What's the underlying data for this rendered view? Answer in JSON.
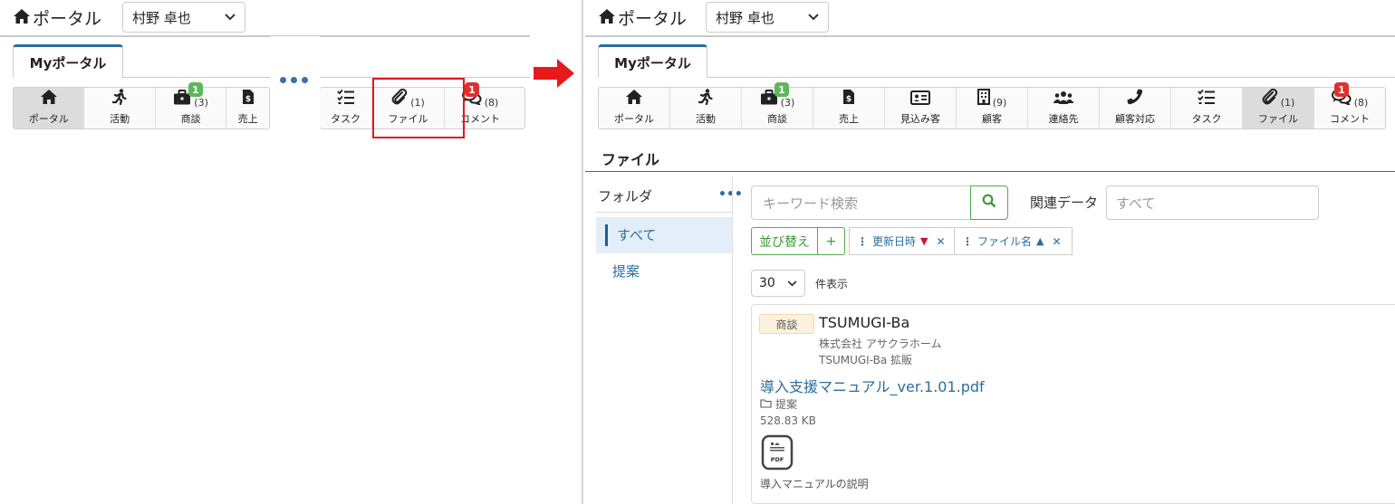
{
  "left": {
    "portal_title": "ポータル",
    "user_select": "村野 卓也",
    "tab_label": "Myポータル",
    "toolbar": [
      {
        "label": "ポータル",
        "icon": "home-icon",
        "glyph": "⌂",
        "count": "",
        "badge": ""
      },
      {
        "label": "活動",
        "icon": "running-icon",
        "glyph": "🏃",
        "count": "",
        "badge": ""
      },
      {
        "label": "商談",
        "icon": "briefcase-icon",
        "glyph": "💼",
        "count": "(3)",
        "badge": "1"
      },
      {
        "label": "売上",
        "icon": "invoice-icon",
        "glyph": "$",
        "count": "",
        "badge": ""
      },
      {
        "label": "タスク",
        "icon": "task-list-icon",
        "glyph": "☰",
        "count": "",
        "badge": ""
      },
      {
        "label": "ファイル",
        "icon": "paperclip-icon",
        "glyph": "📎",
        "count": "(1)",
        "badge": ""
      },
      {
        "label": "コメント",
        "icon": "comments-icon",
        "glyph": "💬",
        "count": "(8)",
        "badge": "1"
      }
    ]
  },
  "arrow_color": "#e8191a",
  "right": {
    "portal_title": "ポータル",
    "user_select": "村野 卓也",
    "tab_label": "Myポータル",
    "toolbar": [
      {
        "label": "ポータル",
        "icon": "home-icon",
        "glyph": "⌂",
        "count": "",
        "badge": ""
      },
      {
        "label": "活動",
        "icon": "running-icon",
        "glyph": "🏃",
        "count": "",
        "badge": ""
      },
      {
        "label": "商談",
        "icon": "briefcase-icon",
        "glyph": "💼",
        "count": "(3)",
        "badge": "1"
      },
      {
        "label": "売上",
        "icon": "invoice-icon",
        "glyph": "$",
        "count": "",
        "badge": ""
      },
      {
        "label": "見込み客",
        "icon": "id-card-icon",
        "glyph": "🪪",
        "count": "",
        "badge": ""
      },
      {
        "label": "顧客",
        "icon": "building-icon",
        "glyph": "🏢",
        "count": "(9)",
        "badge": ""
      },
      {
        "label": "連絡先",
        "icon": "users-icon",
        "glyph": "👥",
        "count": "",
        "badge": ""
      },
      {
        "label": "顧客対応",
        "icon": "phone-icon",
        "glyph": "📞",
        "count": "",
        "badge": ""
      },
      {
        "label": "タスク",
        "icon": "task-list-icon",
        "glyph": "☰",
        "count": "",
        "badge": ""
      },
      {
        "label": "ファイル",
        "icon": "paperclip-icon",
        "glyph": "📎",
        "count": "(1)",
        "badge": ""
      },
      {
        "label": "コメント",
        "icon": "comments-icon",
        "glyph": "💬",
        "count": "(8)",
        "badge": "1"
      }
    ],
    "section_title": "ファイル",
    "folder": {
      "heading": "フォルダ",
      "items": [
        "すべて",
        "提案"
      ]
    },
    "search": {
      "placeholder": "キーワード検索",
      "related_label": "関連データ",
      "related_value": "すべて"
    },
    "sort": {
      "label": "並び替え",
      "add": "+",
      "chips": [
        {
          "label": "更新日時",
          "dir": "▼",
          "dir_color": "#d0103a"
        },
        {
          "label": "ファイル名",
          "dir": "▲",
          "dir_color": "#2a6e9e"
        }
      ]
    },
    "per_page": {
      "value": "30",
      "suffix": "件表示"
    },
    "card": {
      "tag": "商談",
      "title": "TSUMUGI-Ba",
      "company": "株式会社 アサクラホーム",
      "deal": "TSUMUGI-Ba 拡販",
      "file_name": "導入支援マニュアル_ver.1.01.pdf",
      "folder": "提案",
      "size": "528.83 KB",
      "pdf_label": "PDF",
      "description": "導入マニュアルの説明"
    }
  }
}
